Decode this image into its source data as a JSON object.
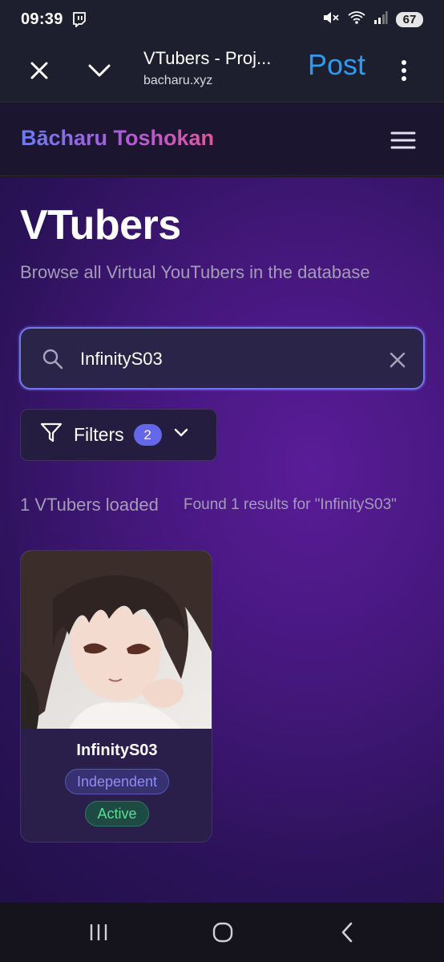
{
  "status_bar": {
    "time": "09:39",
    "battery": "67",
    "app_icon": "twitch-icon",
    "icons": [
      "mute-icon",
      "wifi-icon",
      "signal-icon"
    ]
  },
  "browser": {
    "title": "VTubers - Proj...",
    "url": "bacharu.xyz",
    "post_label": "Post",
    "icons": [
      "close-icon",
      "chevron-down-icon",
      "more-vert-icon"
    ]
  },
  "site": {
    "logo": "Bācharu Toshokan",
    "menu_icon": "hamburger-icon"
  },
  "page": {
    "title": "VTubers",
    "subtitle": "Browse all Virtual YouTubers in the database"
  },
  "search": {
    "value": "InfinityS03",
    "icon": "search-icon",
    "clear_icon": "close-icon"
  },
  "filters": {
    "label": "Filters",
    "count": "2",
    "icon": "filter-icon",
    "chevron": "chevron-down-icon"
  },
  "results": {
    "loaded": "1 VTubers loaded",
    "found": "Found 1 results for \"InfinityS03\""
  },
  "cards": [
    {
      "name": "InfinityS03",
      "affiliation": "Independent",
      "status": "Active"
    }
  ],
  "colors": {
    "accent": "#7477f2",
    "post_blue": "#2e9bf0",
    "active_green": "#5fdc95",
    "independent_purple": "#8f8cf3"
  },
  "nav_bar": {
    "icons": [
      "recents-icon",
      "home-icon",
      "back-icon"
    ]
  }
}
